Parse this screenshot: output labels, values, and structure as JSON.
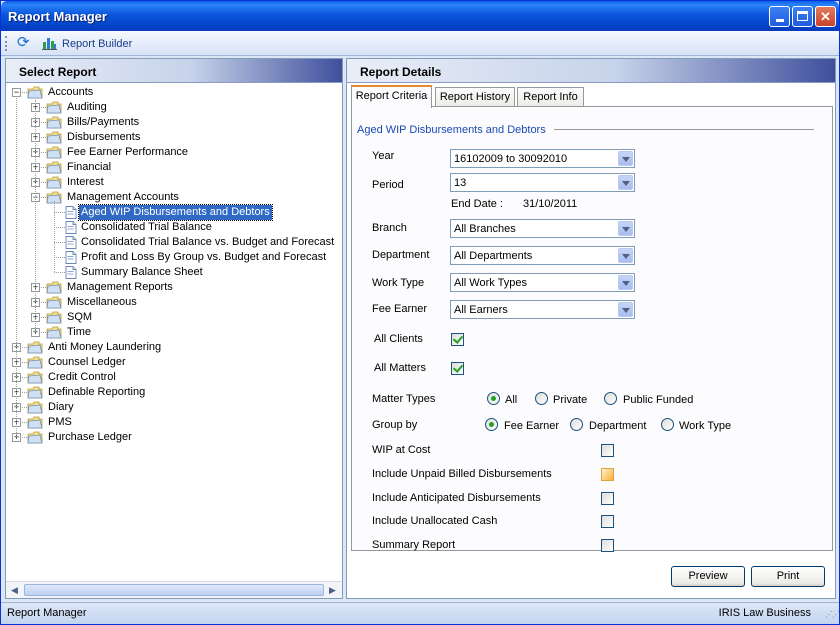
{
  "window": {
    "title": "Report Manager"
  },
  "toolbar": {
    "report_builder": "Report Builder"
  },
  "left_panel": {
    "header": "Select Report"
  },
  "tree": [
    {
      "label": "Accounts",
      "level": 0,
      "expander": "-",
      "type": "folder"
    },
    {
      "label": "Auditing",
      "level": 1,
      "expander": "+",
      "type": "folder"
    },
    {
      "label": "Bills/Payments",
      "level": 1,
      "expander": "+",
      "type": "folder"
    },
    {
      "label": "Disbursements",
      "level": 1,
      "expander": "+",
      "type": "folder"
    },
    {
      "label": "Fee Earner Performance",
      "level": 1,
      "expander": "+",
      "type": "folder"
    },
    {
      "label": "Financial",
      "level": 1,
      "expander": "+",
      "type": "folder"
    },
    {
      "label": "Interest",
      "level": 1,
      "expander": "+",
      "type": "folder"
    },
    {
      "label": "Management Accounts",
      "level": 1,
      "expander": "-",
      "type": "folder"
    },
    {
      "label": "Aged WIP Disbursements and Debtors",
      "level": 2,
      "type": "doc",
      "selected": true
    },
    {
      "label": "Consolidated Trial Balance",
      "level": 2,
      "type": "doc"
    },
    {
      "label": "Consolidated Trial Balance vs. Budget and Forecast",
      "level": 2,
      "type": "doc"
    },
    {
      "label": "Profit and Loss By Group vs. Budget and Forecast",
      "level": 2,
      "type": "doc"
    },
    {
      "label": "Summary Balance Sheet",
      "level": 2,
      "type": "doc"
    },
    {
      "label": "Management Reports",
      "level": 1,
      "expander": "+",
      "type": "folder"
    },
    {
      "label": "Miscellaneous",
      "level": 1,
      "expander": "+",
      "type": "folder"
    },
    {
      "label": "SQM",
      "level": 1,
      "expander": "+",
      "type": "folder"
    },
    {
      "label": "Time",
      "level": 1,
      "expander": "+",
      "type": "folder"
    },
    {
      "label": "Anti Money Laundering",
      "level": 0,
      "expander": "+",
      "type": "folder"
    },
    {
      "label": "Counsel Ledger",
      "level": 0,
      "expander": "+",
      "type": "folder"
    },
    {
      "label": "Credit Control",
      "level": 0,
      "expander": "+",
      "type": "folder"
    },
    {
      "label": "Definable Reporting",
      "level": 0,
      "expander": "+",
      "type": "folder"
    },
    {
      "label": "Diary",
      "level": 0,
      "expander": "+",
      "type": "folder"
    },
    {
      "label": "PMS",
      "level": 0,
      "expander": "+",
      "type": "folder"
    },
    {
      "label": "Purchase Ledger",
      "level": 0,
      "expander": "+",
      "type": "folder"
    }
  ],
  "right_panel": {
    "header": "Report Details",
    "tabs": [
      "Report Criteria",
      "Report History",
      "Report Info"
    ],
    "active_tab": "Report Criteria",
    "group_title": "Aged WIP Disbursements and Debtors",
    "year": {
      "label": "Year",
      "value": "16102009 to 30092010"
    },
    "period": {
      "label": "Period",
      "value": "13"
    },
    "end_date": {
      "label": "End Date :",
      "value": "31/10/2011"
    },
    "branch": {
      "label": "Branch",
      "value": "All Branches"
    },
    "department": {
      "label": "Department",
      "value": "All Departments"
    },
    "work_type": {
      "label": "Work Type",
      "value": "All Work Types"
    },
    "fee_earner": {
      "label": "Fee Earner",
      "value": "All Earners"
    },
    "all_clients": {
      "label": "All Clients",
      "checked": true
    },
    "all_matters": {
      "label": "All Matters",
      "checked": true
    },
    "matter_types": {
      "label": "Matter Types",
      "options": [
        "All",
        "Private",
        "Public Funded"
      ],
      "selected": "All"
    },
    "group_by": {
      "label": "Group by",
      "options": [
        "Fee Earner",
        "Department",
        "Work Type"
      ],
      "selected": "Fee Earner"
    },
    "wip_at_cost": {
      "label": "WIP at Cost",
      "checked": false
    },
    "include_unpaid": {
      "label": "Include Unpaid Billed Disbursements",
      "checked": false
    },
    "include_anticipated": {
      "label": "Include Anticipated Disbursements",
      "checked": false
    },
    "include_unallocated": {
      "label": "Include Unallocated Cash",
      "checked": false
    },
    "summary_report": {
      "label": "Summary Report",
      "checked": false
    },
    "preview_button": "Preview",
    "print_button": "Print"
  },
  "status_bar": {
    "left": "Report Manager",
    "right": "IRIS Law Business"
  },
  "colors": {
    "title_bar": "#0a56dc",
    "selection": "#316ac5",
    "group_title": "#1a49b6",
    "check_mark": "#21a121"
  }
}
